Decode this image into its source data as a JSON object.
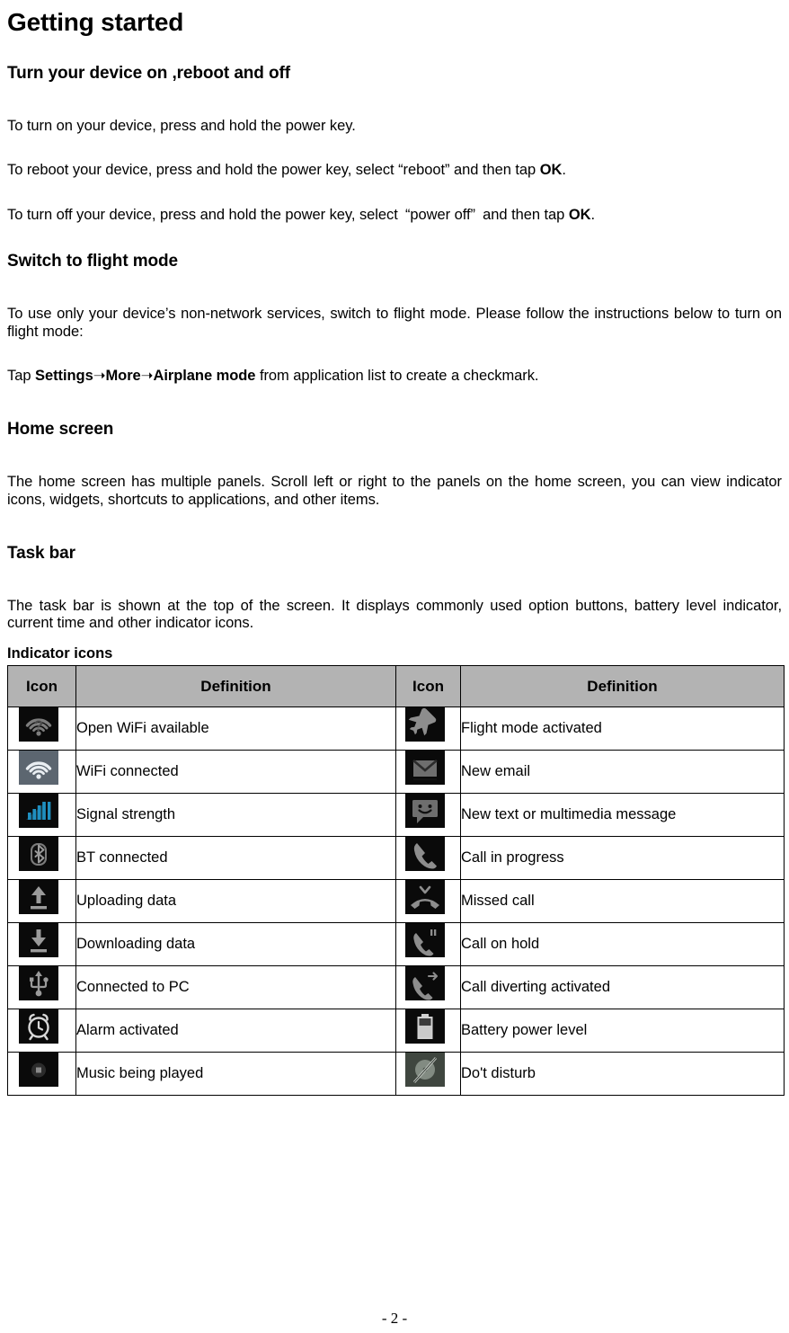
{
  "document": {
    "title": "Getting started",
    "footer": "- 2 -"
  },
  "sections": {
    "power": {
      "heading": "Turn your device on ,reboot and off",
      "p1": "To turn on your device, press and hold the power key.",
      "p2_a": "To reboot your device, press and hold the power key, select “reboot” and then tap ",
      "p2_b": "OK",
      "p2_c": ".",
      "p3_a": "To turn off your device, press and hold the power key, select “power off” and then tap ",
      "p3_b": "OK",
      "p3_c": "."
    },
    "flight": {
      "heading": "Switch to flight mode",
      "p1": "To use only your device’s non-network services, switch to flight mode. Please follow the instructions below to turn on flight mode:",
      "p2_pre": "Tap ",
      "p2_path": "Settings➝More➝Airplane mode",
      "p2_post": " from application list to create a checkmark."
    },
    "home": {
      "heading": "Home screen",
      "p1": "The home screen has multiple panels. Scroll left or right to the panels on the home screen, you can view indicator icons, widgets, shortcuts to applications, and other items."
    },
    "taskbar": {
      "heading": "Task bar",
      "p1": "The task bar is shown at the top of the screen. It displays commonly used option buttons, battery level indicator, current time and other indicator icons.",
      "subheading": "Indicator icons"
    }
  },
  "table": {
    "headers": [
      "Icon",
      "Definition",
      "Icon",
      "Definition"
    ],
    "header_bg": "#b3b3b3",
    "rows": [
      {
        "left": {
          "icon": "wifi-available-icon",
          "label": "Open WiFi available"
        },
        "right": {
          "icon": "airplane-icon",
          "label": "Flight mode activated"
        }
      },
      {
        "left": {
          "icon": "wifi-connected-icon",
          "label": "WiFi connected"
        },
        "right": {
          "icon": "envelope-icon",
          "label": "New email"
        }
      },
      {
        "left": {
          "icon": "signal-bars-icon",
          "label": "Signal strength"
        },
        "right": {
          "icon": "message-bubble-icon",
          "label": "New text or multimedia message"
        }
      },
      {
        "left": {
          "icon": "bluetooth-icon",
          "label": "BT connected"
        },
        "right": {
          "icon": "phone-call-icon",
          "label": "Call in progress"
        }
      },
      {
        "left": {
          "icon": "upload-arrow-icon",
          "label": "Uploading data"
        },
        "right": {
          "icon": "missed-call-icon",
          "label": "Missed call"
        }
      },
      {
        "left": {
          "icon": "download-arrow-icon",
          "label": "Downloading data"
        },
        "right": {
          "icon": "call-on-hold-icon",
          "label": "Call on hold"
        }
      },
      {
        "left": {
          "icon": "usb-icon",
          "label": "Connected to PC"
        },
        "right": {
          "icon": "call-divert-icon",
          "label": "Call diverting activated"
        }
      },
      {
        "left": {
          "icon": "alarm-clock-icon",
          "label": "Alarm activated"
        },
        "right": {
          "icon": "battery-icon",
          "label": "Battery power level"
        }
      },
      {
        "left": {
          "icon": "music-note-icon",
          "label": "Music being played"
        },
        "right": {
          "icon": "do-not-disturb-icon",
          "label": "Do't disturb"
        }
      }
    ]
  },
  "colors": {
    "signal_blue": "#1f8fc0",
    "icon_dark_bg": "#0a0a0a",
    "icon_gray_bg": "#5c6670",
    "icon_fg": "#8d8d8d",
    "table_header": "#b3b3b3"
  }
}
